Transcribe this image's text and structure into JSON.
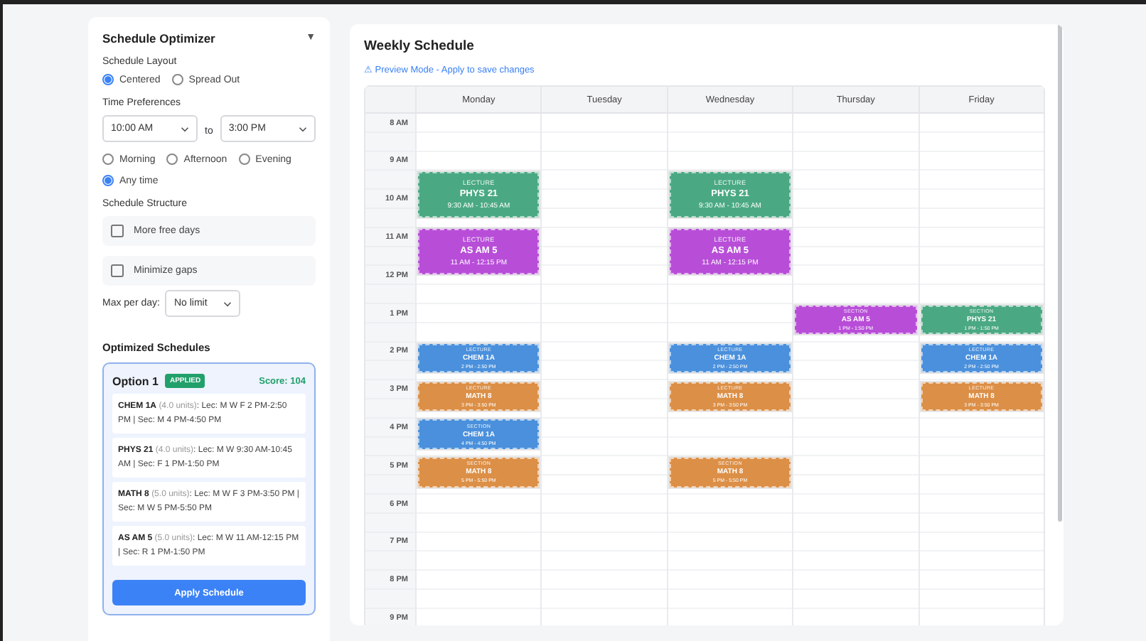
{
  "sidebar": {
    "title": "Schedule Optimizer",
    "toggle": "▼",
    "layout": {
      "label": "Schedule Layout",
      "options": [
        {
          "label": "Centered",
          "selected": true
        },
        {
          "label": "Spread Out",
          "selected": false
        }
      ]
    },
    "time_preferences": {
      "label": "Time Preferences",
      "from": "10:00 AM",
      "to_label": "to",
      "to": "3:00 PM",
      "periods": [
        {
          "label": "Morning",
          "selected": false
        },
        {
          "label": "Afternoon",
          "selected": false
        },
        {
          "label": "Evening",
          "selected": false
        },
        {
          "label": "Any time",
          "selected": true
        }
      ]
    },
    "structure": {
      "label": "Schedule Structure",
      "options": [
        {
          "label": "More free days",
          "checked": false
        },
        {
          "label": "Minimize gaps",
          "checked": false
        }
      ]
    },
    "max_per_day": {
      "label": "Max per day:",
      "value": "No limit"
    }
  },
  "optimized": {
    "title": "Optimized Schedules",
    "options": [
      {
        "title": "Option 1",
        "badge": "APPLIED",
        "score": "Score: 104",
        "selected": true,
        "courses": [
          {
            "code": "CHEM 1A",
            "units": "(4.0 units)",
            "details": ": Lec: M W F 2 PM-2:50 PM | Sec: M 4 PM-4:50 PM"
          },
          {
            "code": "PHYS 21",
            "units": "(4.0 units)",
            "details": ": Lec: M W 9:30 AM-10:45 AM | Sec: F 1 PM-1:50 PM"
          },
          {
            "code": "MATH 8",
            "units": "(5.0 units)",
            "details": ": Lec: M W F 3 PM-3:50 PM | Sec: M W 5 PM-5:50 PM"
          },
          {
            "code": "AS AM 5",
            "units": "(5.0 units)",
            "details": ": Lec: M W 11 AM-12:15 PM | Sec: R 1 PM-1:50 PM"
          }
        ],
        "button": "Apply Schedule"
      }
    ]
  },
  "schedule": {
    "title": "Weekly Schedule",
    "notice": "⚠ Preview Mode - Apply to save changes",
    "times": [
      "8 AM",
      "9 AM",
      "10 AM",
      "11 AM",
      "12 PM",
      "1 PM",
      "2 PM",
      "3 PM",
      "4 PM",
      "5 PM",
      "6 PM",
      "7 PM",
      "8 PM",
      "9 PM"
    ],
    "days": [
      {
        "name": "Monday",
        "events": [
          {
            "type": "LECTURE",
            "course": "PHYS 21",
            "time": "9:30 AM - 10:45 AM",
            "color": "#4aa983"
          },
          {
            "type": "LECTURE",
            "course": "AS AM 5",
            "time": "11 AM - 12:15 PM",
            "color": "#b84ed8"
          },
          {
            "type": "LECTURE",
            "course": "CHEM 1A",
            "time": "2 PM - 2:50 PM",
            "color": "#4a90dc"
          },
          {
            "type": "LECTURE",
            "course": "MATH 8",
            "time": "3 PM - 3:50 PM",
            "color": "#dc8f46"
          },
          {
            "type": "SECTION",
            "course": "CHEM 1A",
            "time": "4 PM - 4:50 PM",
            "color": "#4a90dc"
          },
          {
            "type": "SECTION",
            "course": "MATH 8",
            "time": "5 PM - 5:50 PM",
            "color": "#dc8f46"
          }
        ]
      },
      {
        "name": "Tuesday"
      },
      {
        "name": "Wednesday",
        "events": [
          {
            "type": "LECTURE",
            "course": "PHYS 21",
            "time": "9:30 AM - 10:45 AM",
            "color": "#4aa983"
          },
          {
            "type": "LECTURE",
            "course": "AS AM 5",
            "time": "11 AM - 12:15 PM",
            "color": "#b84ed8"
          },
          {
            "type": "LECTURE",
            "course": "CHEM 1A",
            "time": "2 PM - 2:50 PM",
            "color": "#4a90dc"
          },
          {
            "type": "LECTURE",
            "course": "MATH 8",
            "time": "3 PM - 3:50 PM",
            "color": "#dc8f46"
          },
          {
            "type": "SECTION",
            "course": "MATH 8",
            "time": "5 PM - 5:50 PM",
            "color": "#dc8f46"
          }
        ]
      },
      {
        "name": "Thursday",
        "events": [
          {
            "type": "SECTION",
            "course": "AS AM 5",
            "time": "1 PM - 1:50 PM",
            "color": "#b84ed8"
          }
        ]
      },
      {
        "name": "Friday",
        "events": [
          {
            "type": "SECTION",
            "course": "PHYS 21",
            "time": "1 PM - 1:50 PM",
            "color": "#4aa983"
          },
          {
            "type": "LECTURE",
            "course": "CHEM 1A",
            "time": "2 PM - 2:50 PM",
            "color": "#4a90dc"
          },
          {
            "type": "LECTURE",
            "course": "MATH 8",
            "time": "3 PM - 3:50 PM",
            "color": "#dc8f46"
          }
        ]
      }
    ]
  }
}
